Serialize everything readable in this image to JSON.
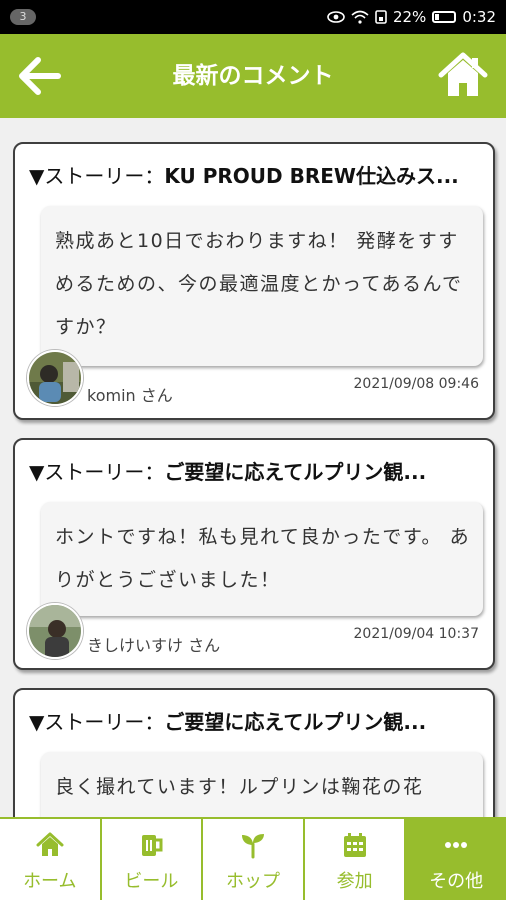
{
  "status_bar": {
    "notification_count": "3",
    "battery": "22%",
    "time": "0:32",
    "icons": [
      "eye-icon",
      "wifi-icon",
      "signal-icon",
      "battery-icon"
    ]
  },
  "header": {
    "title": "最新のコメント",
    "back_icon": "arrow-left-icon",
    "home_icon": "home-icon",
    "color": "#97bd2d"
  },
  "comments": [
    {
      "story_prefix": "▼ストーリー：",
      "story_title": "KU PROUD BREW仕込みス...",
      "text": "熟成あと10日でおわりますね！ 発酵をすすめるための、今の最適温度とかってあるんですか？",
      "author": "komin さん",
      "date": "2021/09/08 09:46"
    },
    {
      "story_prefix": "▼ストーリー：",
      "story_title": "ご要望に応えてルプリン観...",
      "text": "ホントですね！私も見れて良かったです。 ありがとうございました！",
      "author": "きしけいすけ さん",
      "date": "2021/09/04 10:37"
    },
    {
      "story_prefix": "▼ストーリー：",
      "story_title": "ご要望に応えてルプリン観...",
      "text": "良く撮れています！ルプリンは鞠花の花"
    }
  ],
  "bottom_nav": [
    {
      "label": "ホーム",
      "icon": "home-icon"
    },
    {
      "label": "ビール",
      "icon": "beer-mug-icon"
    },
    {
      "label": "ホップ",
      "icon": "sprout-icon"
    },
    {
      "label": "参加",
      "icon": "calendar-icon"
    },
    {
      "label": "その他",
      "icon": "more-dots-icon",
      "active": true
    }
  ]
}
